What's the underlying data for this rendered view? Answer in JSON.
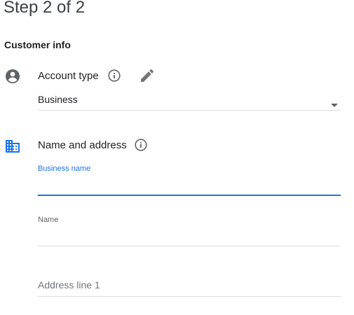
{
  "header": {
    "step_title": "Step 2 of 2"
  },
  "section": {
    "title": "Customer info"
  },
  "account_type": {
    "label": "Account type",
    "icon": "account-circle-icon",
    "info_icon": "info-icon",
    "edit_icon": "pencil-icon",
    "select": {
      "value": "Business",
      "arrow_icon": "dropdown-arrow-icon"
    }
  },
  "name_address": {
    "label": "Name and address",
    "icon": "building-icon",
    "info_icon": "info-icon",
    "fields": {
      "business_name": {
        "label": "Business name",
        "value": "",
        "state": "focused"
      },
      "name": {
        "label": "Name",
        "value": ""
      },
      "address_line_1": {
        "placeholder": "Address line 1",
        "value": ""
      }
    }
  },
  "colors": {
    "accent": "#1a73e8",
    "icon_gray": "#5f6368",
    "text": "#202124",
    "divider": "#dadce0"
  }
}
